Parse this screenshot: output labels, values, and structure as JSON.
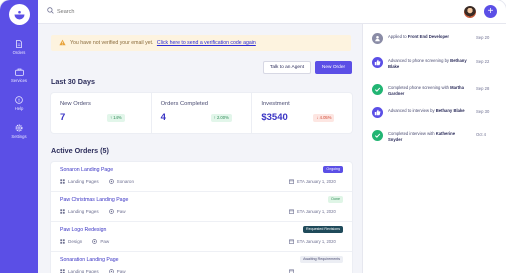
{
  "sidebar": {
    "items": [
      {
        "label": "Orders",
        "icon": "orders-icon"
      },
      {
        "label": "Services",
        "icon": "services-icon"
      },
      {
        "label": "Help",
        "icon": "help-icon"
      },
      {
        "label": "Settings",
        "icon": "settings-icon"
      }
    ]
  },
  "topbar": {
    "search_placeholder": "Search",
    "add_label": "+"
  },
  "alert": {
    "text": "You have not verified your email yet.",
    "link": "Click here to send a verification code again"
  },
  "actions": {
    "talk_label": "Talk to an Agent",
    "new_order_label": "New Order"
  },
  "stats_section": {
    "title": "Last 30 Days",
    "items": [
      {
        "label": "New Orders",
        "value": "7",
        "change": "14%",
        "direction": "up"
      },
      {
        "label": "Orders Completed",
        "value": "4",
        "change": "2.00%",
        "direction": "up"
      },
      {
        "label": "Investment",
        "value": "$3540",
        "change": "4.05%",
        "direction": "down"
      }
    ]
  },
  "orders_section": {
    "title": "Active Orders (5)",
    "items": [
      {
        "title": "Sonaron Landing Page",
        "category": "Landing Pages",
        "vendor": "Sonaron",
        "eta": "ETA January 1, 2020",
        "status": "Ongoing",
        "status_bg": "#5b4fe6",
        "status_fg": "#ffffff"
      },
      {
        "title": "Paw Christmas Landing Page",
        "category": "Landing Pages",
        "vendor": "Paw",
        "eta": "ETA January 1, 2020",
        "status": "Done",
        "status_bg": "#dff5e6",
        "status_fg": "#2e8a56"
      },
      {
        "title": "Paw Logo Redesign",
        "category": "Design",
        "vendor": "Paw",
        "eta": "ETA January 1, 2020",
        "status": "Requested Revisions",
        "status_bg": "#1f4a5a",
        "status_fg": "#ffffff"
      },
      {
        "title": "Sonaration Landing Page",
        "category": "Landing Pages",
        "vendor": "Paw",
        "eta": "",
        "status": "Awaiting Requirements",
        "status_bg": "#eceef4",
        "status_fg": "#4a4c72"
      }
    ]
  },
  "activity": [
    {
      "pre": "Applied to",
      "bold": "Front End Developer",
      "post": "",
      "date": "Sep 20",
      "color": "#8a8ca6",
      "icon": "user-icon"
    },
    {
      "pre": "Advanced to phone screening by",
      "bold": "Bethany Blake",
      "post": "",
      "date": "Sep 22",
      "color": "#5b4fe6",
      "icon": "thumbs-up-icon"
    },
    {
      "pre": "Completed phone screening with",
      "bold": "Martha Gardner",
      "post": "",
      "date": "Sep 28",
      "color": "#22b573",
      "icon": "check-icon"
    },
    {
      "pre": "Advanced to interview by",
      "bold": "Bethany",
      "post": "Blake",
      "date": "Sep 30",
      "color": "#5b4fe6",
      "icon": "thumbs-up-icon"
    },
    {
      "pre": "Completed interview with",
      "bold": "Katherine",
      "post": "Snyder",
      "date": "Oct 4",
      "color": "#22b573",
      "icon": "check-icon"
    }
  ],
  "colors": {
    "brand": "#5b4fe6",
    "warning_bg": "#fdf3df",
    "success": "#22b573",
    "danger": "#d24a36"
  }
}
